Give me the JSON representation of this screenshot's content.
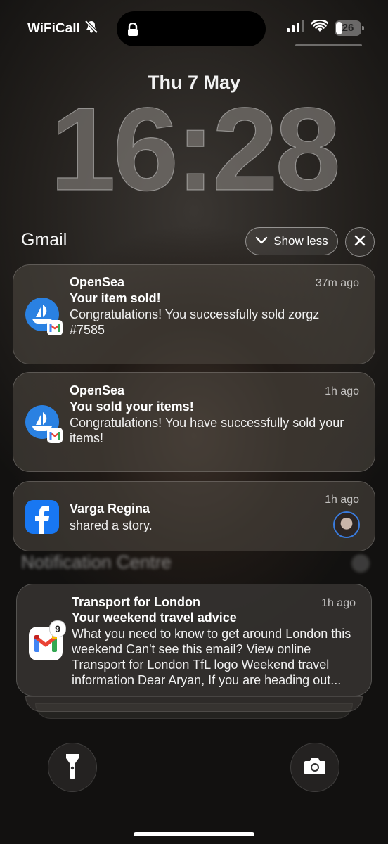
{
  "status_bar": {
    "carrier": "WiFiCall",
    "battery": "26",
    "battery_level": 0.26
  },
  "lock_screen": {
    "date": "Thu 7 May",
    "time": "16:28"
  },
  "notification_group": {
    "app": "Gmail",
    "show_less_label": "Show less"
  },
  "notifications": [
    {
      "sender": "OpenSea",
      "subject": "Your item sold!",
      "body": "Congratulations! You successfully sold zorgz #7585",
      "time": "37m ago"
    },
    {
      "sender": "OpenSea",
      "subject": "You sold your items!",
      "body": "Congratulations! You have successfully sold your items!",
      "time": "1h ago"
    },
    {
      "sender": "Varga Regina",
      "body": "shared a story.",
      "time": "1h ago"
    }
  ],
  "notification_centre": {
    "label": "Notification Centre"
  },
  "stacked_notification": {
    "sender": "Transport for London",
    "subject": "Your weekend travel advice",
    "body": "What you need to know to get around London this weekend Can't see this email? View online Transport for London TfL logo Weekend travel information Dear Aryan, If you are heading out...",
    "time": "1h ago",
    "badge_count": "9"
  },
  "colors": {
    "opensea_blue": "#2a81e2",
    "facebook_blue": "#1877f2"
  }
}
